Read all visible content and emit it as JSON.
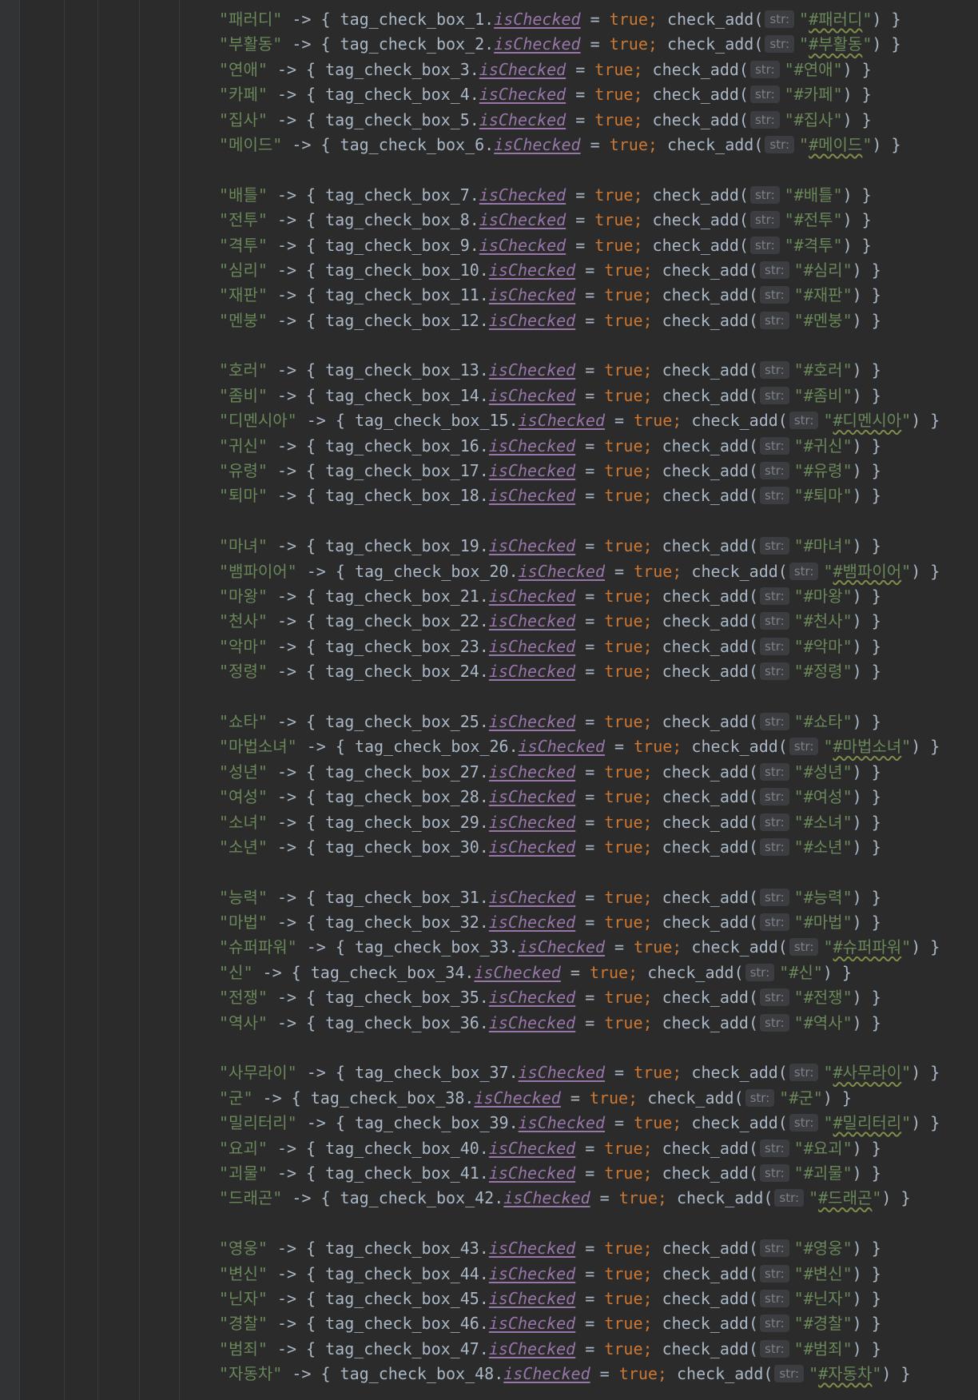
{
  "editor": {
    "param_hint": "str:",
    "arrow": "->",
    "assign": "=",
    "value": "true",
    "func": "check_add(",
    "prop": "isChecked",
    "box_prefix": "tag_check_box_"
  },
  "lines": [
    {
      "key": "패러디",
      "n": "1",
      "tag": "#패러디",
      "wavy": true
    },
    {
      "key": "부활동",
      "n": "2",
      "tag": "#부활동",
      "wavy": true
    },
    {
      "key": "연애",
      "n": "3",
      "tag": "#연애",
      "wavy": false
    },
    {
      "key": "카페",
      "n": "4",
      "tag": "#카페",
      "wavy": false
    },
    {
      "key": "집사",
      "n": "5",
      "tag": "#집사",
      "wavy": false
    },
    {
      "key": "메이드",
      "n": "6",
      "tag": "#메이드",
      "wavy": true
    },
    null,
    {
      "key": "배틀",
      "n": "7",
      "tag": "#배틀",
      "wavy": false
    },
    {
      "key": "전투",
      "n": "8",
      "tag": "#전투",
      "wavy": false
    },
    {
      "key": "격투",
      "n": "9",
      "tag": "#격투",
      "wavy": false
    },
    {
      "key": "심리",
      "n": "10",
      "tag": "#심리",
      "wavy": false
    },
    {
      "key": "재판",
      "n": "11",
      "tag": "#재판",
      "wavy": false
    },
    {
      "key": "멘붕",
      "n": "12",
      "tag": "#멘붕",
      "wavy": false
    },
    null,
    {
      "key": "호러",
      "n": "13",
      "tag": "#호러",
      "wavy": false
    },
    {
      "key": "좀비",
      "n": "14",
      "tag": "#좀비",
      "wavy": false
    },
    {
      "key": "디멘시아",
      "n": "15",
      "tag": "#디멘시아",
      "wavy": true
    },
    {
      "key": "귀신",
      "n": "16",
      "tag": "#귀신",
      "wavy": false
    },
    {
      "key": "유령",
      "n": "17",
      "tag": "#유령",
      "wavy": false
    },
    {
      "key": "퇴마",
      "n": "18",
      "tag": "#퇴마",
      "wavy": false
    },
    null,
    {
      "key": "마녀",
      "n": "19",
      "tag": "#마녀",
      "wavy": false
    },
    {
      "key": "뱀파이어",
      "n": "20",
      "tag": "#뱀파이어",
      "wavy": true
    },
    {
      "key": "마왕",
      "n": "21",
      "tag": "#마왕",
      "wavy": false
    },
    {
      "key": "천사",
      "n": "22",
      "tag": "#천사",
      "wavy": false
    },
    {
      "key": "악마",
      "n": "23",
      "tag": "#악마",
      "wavy": false
    },
    {
      "key": "정령",
      "n": "24",
      "tag": "#정령",
      "wavy": false
    },
    null,
    {
      "key": "쇼타",
      "n": "25",
      "tag": "#쇼타",
      "wavy": false
    },
    {
      "key": "마법소녀",
      "n": "26",
      "tag": "#마법소녀",
      "wavy": true
    },
    {
      "key": "성년",
      "n": "27",
      "tag": "#성년",
      "wavy": false
    },
    {
      "key": "여성",
      "n": "28",
      "tag": "#여성",
      "wavy": false
    },
    {
      "key": "소녀",
      "n": "29",
      "tag": "#소녀",
      "wavy": false
    },
    {
      "key": "소년",
      "n": "30",
      "tag": "#소년",
      "wavy": false
    },
    null,
    {
      "key": "능력",
      "n": "31",
      "tag": "#능력",
      "wavy": false
    },
    {
      "key": "마법",
      "n": "32",
      "tag": "#마법",
      "wavy": false
    },
    {
      "key": "슈퍼파워",
      "n": "33",
      "tag": "#슈퍼파워",
      "wavy": true
    },
    {
      "key": "신",
      "n": "34",
      "tag": "#신",
      "wavy": false
    },
    {
      "key": "전쟁",
      "n": "35",
      "tag": "#전쟁",
      "wavy": false
    },
    {
      "key": "역사",
      "n": "36",
      "tag": "#역사",
      "wavy": false
    },
    null,
    {
      "key": "사무라이",
      "n": "37",
      "tag": "#사무라이",
      "wavy": true
    },
    {
      "key": "군",
      "n": "38",
      "tag": "#군",
      "wavy": false
    },
    {
      "key": "밀리터리",
      "n": "39",
      "tag": "#밀리터리",
      "wavy": true
    },
    {
      "key": "요괴",
      "n": "40",
      "tag": "#요괴",
      "wavy": false
    },
    {
      "key": "괴물",
      "n": "41",
      "tag": "#괴물",
      "wavy": false
    },
    {
      "key": "드래곤",
      "n": "42",
      "tag": "#드래곤",
      "wavy": true
    },
    null,
    {
      "key": "영웅",
      "n": "43",
      "tag": "#영웅",
      "wavy": false
    },
    {
      "key": "변신",
      "n": "44",
      "tag": "#변신",
      "wavy": false
    },
    {
      "key": "닌자",
      "n": "45",
      "tag": "#닌자",
      "wavy": false
    },
    {
      "key": "경찰",
      "n": "46",
      "tag": "#경찰",
      "wavy": false
    },
    {
      "key": "범죄",
      "n": "47",
      "tag": "#범죄",
      "wavy": false
    },
    {
      "key": "자동차",
      "n": "48",
      "tag": "#자동차",
      "wavy": true
    }
  ]
}
